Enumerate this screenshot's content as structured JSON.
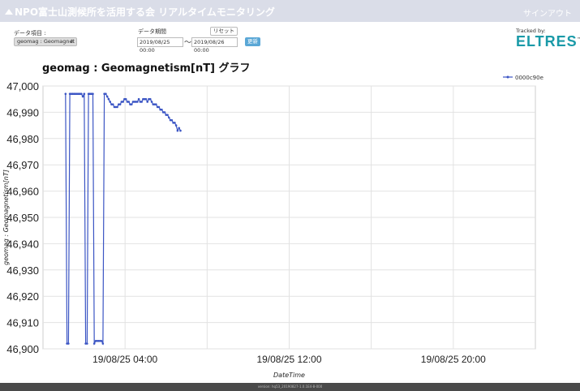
{
  "header": {
    "title": "NPO富士山測候所を活用する会 リアルタイムモニタリング",
    "signin_label": "サインアウト"
  },
  "controls": {
    "data_item_label": "データ項目 :",
    "data_item_value": "geomag : Geomagnet",
    "period_label": "データ期間",
    "start_date": "2019/08/25 00:00",
    "tilde": "〜",
    "end_date": "2019/08/26 00:00",
    "reset_label": "リセット",
    "update_label": "更新"
  },
  "tracked": {
    "label": "Tracked by:",
    "logo_text": "ELTRES",
    "trademark": "™"
  },
  "footer": {
    "text": "version: hq53_20190827-1.0.1E4-8-000"
  },
  "colors": {
    "series": "#3b55c4",
    "header_bg": "#dadde8",
    "update_button": "#5aa7d6",
    "logo": "#1a9aa8"
  },
  "chart_data": {
    "type": "line",
    "title": "geomag : Geomagnetism[nT] グラフ",
    "xlabel": "DateTime",
    "ylabel": "geomag : Geomagnetism[nT]",
    "ylim": [
      46900,
      47000
    ],
    "yticks": [
      46900,
      46910,
      46920,
      46930,
      46940,
      46950,
      46960,
      46970,
      46980,
      46990,
      47000
    ],
    "ytick_labels": [
      "46,900",
      "46,910",
      "46,920",
      "46,930",
      "46,940",
      "46,950",
      "46,960",
      "46,970",
      "46,980",
      "46,990",
      "47,000"
    ],
    "xlim_hours": [
      0,
      24
    ],
    "xticks_hours": [
      4,
      12,
      20
    ],
    "xtick_labels": [
      "19/08/25 04:00",
      "19/08/25 12:00",
      "19/08/25 20:00"
    ],
    "grid": true,
    "legend_position": "top-right",
    "series": [
      {
        "name": "0000c90e",
        "x_hours": [
          1.1,
          1.17,
          1.24,
          1.31,
          1.38,
          1.45,
          1.52,
          1.59,
          1.66,
          1.73,
          1.8,
          1.87,
          1.94,
          2.01,
          2.08,
          2.15,
          2.22,
          2.29,
          2.36,
          2.43,
          2.5,
          2.57,
          2.64,
          2.71,
          2.78,
          2.85,
          2.92,
          2.99,
          3.06,
          3.13,
          3.2,
          3.27,
          3.34,
          3.41,
          3.48,
          3.55,
          3.62,
          3.69,
          3.76,
          3.83,
          3.9,
          3.97,
          4.04,
          4.11,
          4.18,
          4.25,
          4.32,
          4.39,
          4.46,
          4.53,
          4.6,
          4.67,
          4.74,
          4.81,
          4.88,
          4.95,
          5.02,
          5.09,
          5.16,
          5.23,
          5.3,
          5.37,
          5.44,
          5.51,
          5.58,
          5.65,
          5.72,
          5.79,
          5.86,
          5.93,
          6.0,
          6.07,
          6.14,
          6.21,
          6.28,
          6.35,
          6.42,
          6.49,
          6.56,
          6.63,
          6.7
        ],
        "values": [
          46997,
          46902,
          46902,
          46997,
          46997,
          46997,
          46997,
          46997,
          46997,
          46997,
          46997,
          46997,
          46996,
          46997,
          46902,
          46902,
          46997,
          46997,
          46997,
          46997,
          46902,
          46903,
          46903,
          46903,
          46903,
          46903,
          46902,
          46997,
          46997,
          46996,
          46995,
          46994,
          46993,
          46993,
          46992,
          46992,
          46992,
          46993,
          46993,
          46994,
          46994,
          46995,
          46995,
          46994,
          46994,
          46993,
          46993,
          46994,
          46994,
          46994,
          46994,
          46995,
          46994,
          46994,
          46995,
          46995,
          46995,
          46994,
          46995,
          46995,
          46994,
          46993,
          46993,
          46993,
          46992,
          46992,
          46991,
          46991,
          46990,
          46990,
          46989,
          46989,
          46988,
          46987,
          46987,
          46986,
          46986,
          46985,
          46983,
          46984,
          46983
        ]
      }
    ]
  }
}
